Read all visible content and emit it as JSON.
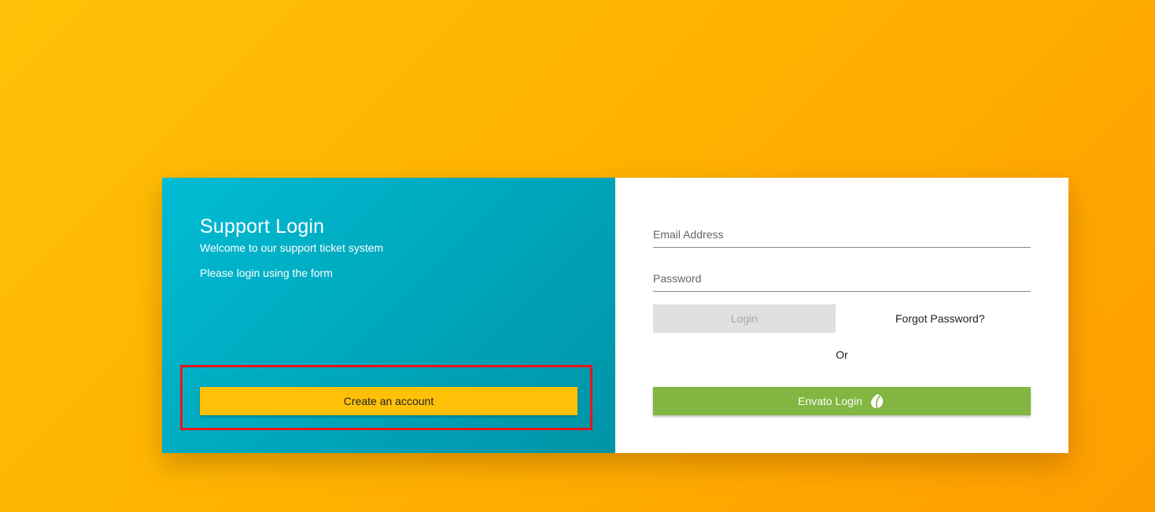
{
  "left_panel": {
    "title": "Support Login",
    "subtitle": "Welcome to our support ticket system",
    "instruction": "Please login using the form",
    "create_account_label": "Create an account"
  },
  "right_panel": {
    "email_placeholder": "Email Address",
    "password_placeholder": "Password",
    "login_label": "Login",
    "forgot_password_label": "Forgot Password?",
    "or_label": "Or",
    "envato_login_label": "Envato Login",
    "envato_icon": "envato-leaf-icon"
  },
  "colors": {
    "background_start": "#ffc107",
    "background_end": "#ff9d00",
    "left_panel": "#00bcd4",
    "create_button": "#ffc107",
    "login_button_disabled": "#e0e0e0",
    "envato_button": "#82b541",
    "highlight_border": "#e8151b"
  }
}
